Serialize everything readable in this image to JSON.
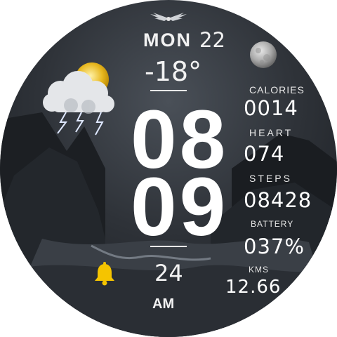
{
  "date": {
    "day": "MON",
    "num": "22"
  },
  "weather": {
    "temperature": "-18°",
    "icon": "thunderstorm-sun-icon"
  },
  "time": {
    "hours": "08",
    "minutes": "09",
    "seconds": "24",
    "ampm": "AM"
  },
  "stats": {
    "calories": {
      "label": "CALORIES",
      "value": "0014"
    },
    "heart": {
      "label": "HEART",
      "value": "074"
    },
    "steps": {
      "label": "STEPS",
      "value": "08428"
    },
    "battery": {
      "label": "BATTERY",
      "value": "037%"
    },
    "kms": {
      "label": "KMS",
      "value": "12.66"
    }
  },
  "icons": {
    "logo": "wings-logo-icon",
    "moon": "moon-phase-icon",
    "alarm": "bell-icon"
  },
  "colors": {
    "text": "#ffffff",
    "bell": "#f5c400",
    "sun": "#e8b820",
    "background": "#2e3238"
  }
}
